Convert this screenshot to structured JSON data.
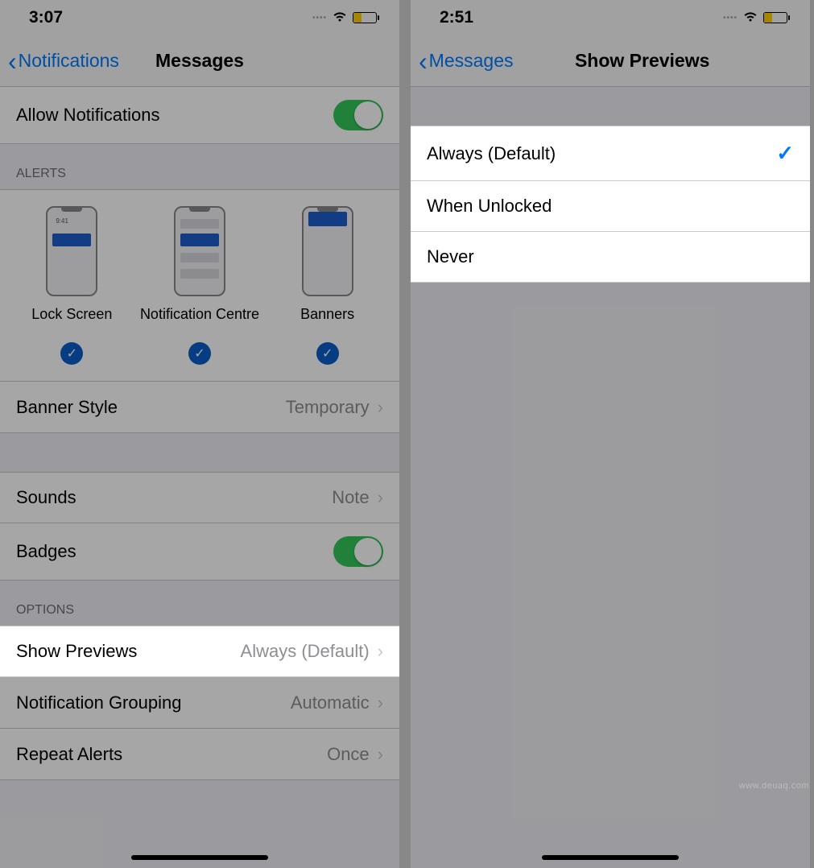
{
  "left": {
    "status_time": "3:07",
    "nav_back": "Notifications",
    "nav_title": "Messages",
    "allow_notifications": "Allow Notifications",
    "alerts_header": "ALERTS",
    "alerts": {
      "lock_screen": "Lock Screen",
      "notification_centre": "Notification Centre",
      "banners": "Banners",
      "preview_time": "9:41"
    },
    "banner_style": {
      "label": "Banner Style",
      "value": "Temporary"
    },
    "sounds": {
      "label": "Sounds",
      "value": "Note"
    },
    "badges": "Badges",
    "options_header": "OPTIONS",
    "show_previews": {
      "label": "Show Previews",
      "value": "Always (Default)"
    },
    "notification_grouping": {
      "label": "Notification Grouping",
      "value": "Automatic"
    },
    "repeat_alerts": {
      "label": "Repeat Alerts",
      "value": "Once"
    }
  },
  "right": {
    "status_time": "2:51",
    "nav_back": "Messages",
    "nav_title": "Show Previews",
    "options": [
      {
        "label": "Always (Default)",
        "selected": true
      },
      {
        "label": "When Unlocked",
        "selected": false
      },
      {
        "label": "Never",
        "selected": false
      }
    ]
  },
  "watermark": "www.deuaq.com"
}
